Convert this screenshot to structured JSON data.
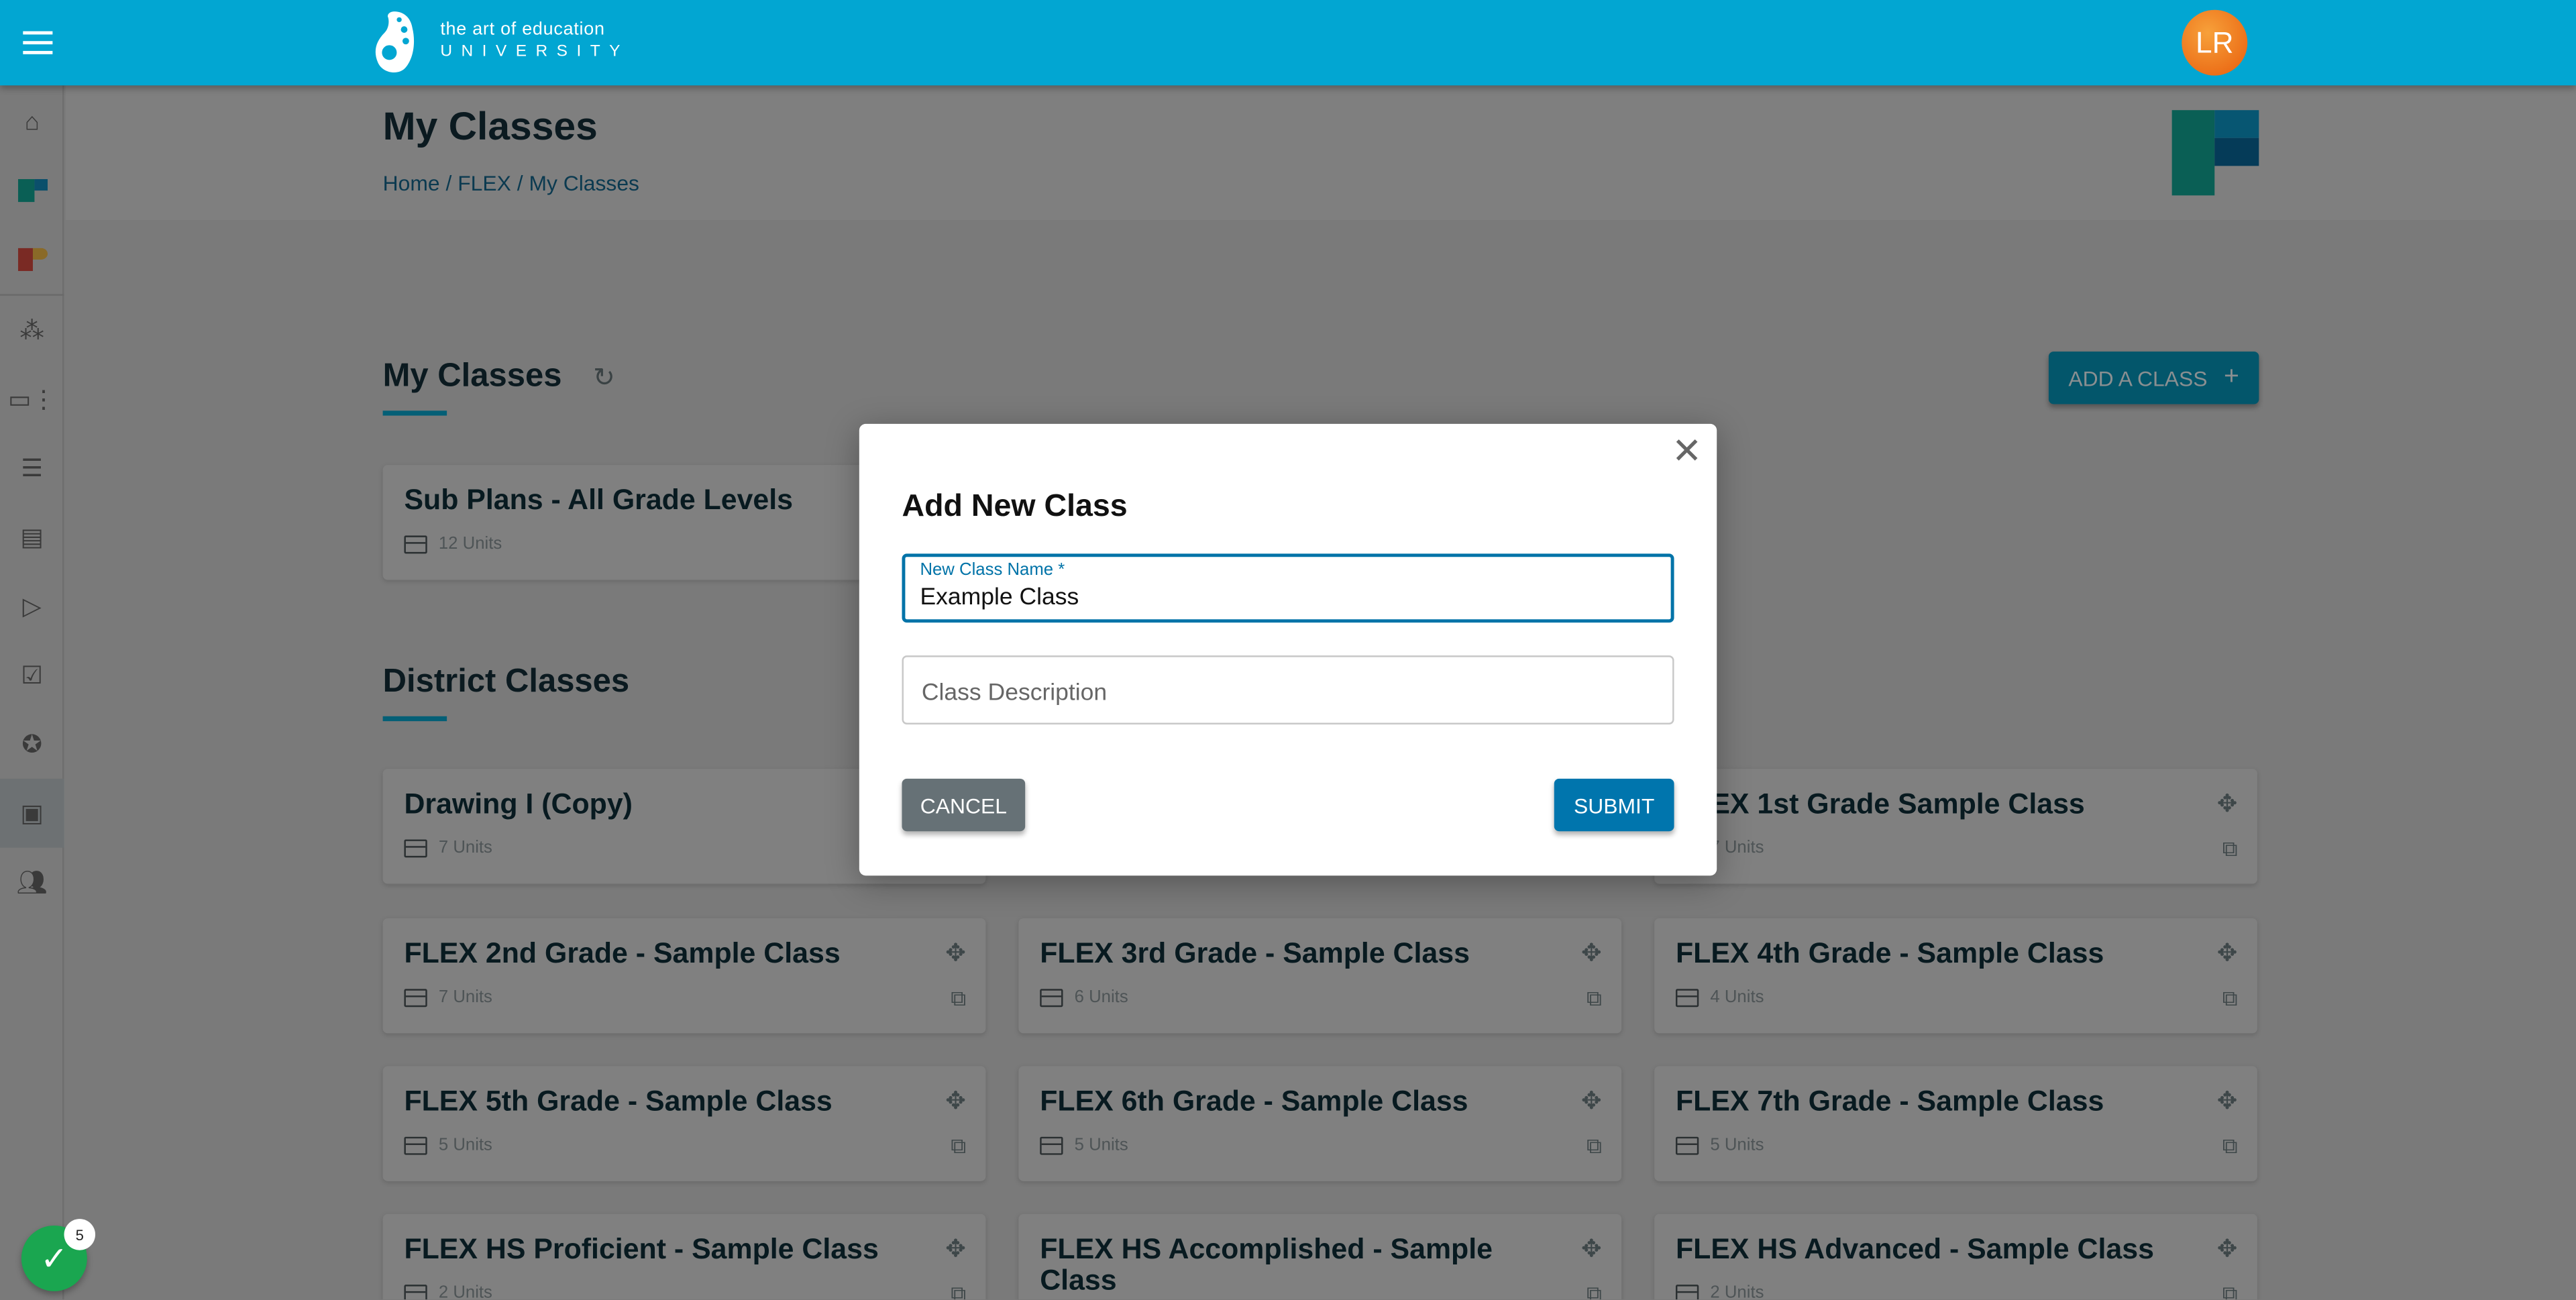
{
  "header": {
    "menu_icon": "hamburger-icon",
    "logo_line1": "the art of education",
    "logo_line2": "UNIVERSITY",
    "avatar_initials": "LR",
    "color": "#02a6d2"
  },
  "sidebar": {
    "items": [
      {
        "icon": "home-icon"
      },
      {
        "icon": "flex-icon"
      },
      {
        "icon": "pro-icon"
      },
      {
        "icon": "hierarchy-icon"
      },
      {
        "icon": "dashboard-icon"
      },
      {
        "icon": "list-icon"
      },
      {
        "icon": "document-icon"
      },
      {
        "icon": "play-icon"
      },
      {
        "icon": "checkbox-icon"
      },
      {
        "icon": "badge-icon"
      },
      {
        "icon": "classes-icon",
        "active": true
      },
      {
        "icon": "users-icon"
      }
    ]
  },
  "page": {
    "title": "My Classes",
    "breadcrumb": [
      "Home",
      "FLEX",
      "My Classes"
    ],
    "breadcrumb_sep": "/"
  },
  "my_classes": {
    "heading": "My Classes",
    "add_button": "ADD A CLASS",
    "cards": [
      {
        "title": "Sub Plans - All Grade Levels",
        "units": "12 Units"
      }
    ]
  },
  "district_classes": {
    "heading": "District Classes",
    "cards": [
      {
        "title": "Drawing I (Copy)",
        "units": "7 Units"
      },
      {
        "title": "",
        "units": ""
      },
      {
        "title": "FLEX 1st Grade Sample Class",
        "units": "7 Units"
      },
      {
        "title": "FLEX 2nd Grade - Sample Class",
        "units": "7 Units"
      },
      {
        "title": "FLEX 3rd Grade - Sample Class",
        "units": "6 Units"
      },
      {
        "title": "FLEX 4th Grade - Sample Class",
        "units": "4 Units"
      },
      {
        "title": "FLEX 5th Grade - Sample Class",
        "units": "5 Units"
      },
      {
        "title": "FLEX 6th Grade - Sample Class",
        "units": "5 Units"
      },
      {
        "title": "FLEX 7th Grade - Sample Class",
        "units": "5 Units"
      },
      {
        "title": "FLEX HS Proficient - Sample Class",
        "units": "2 Units"
      },
      {
        "title": "FLEX HS Accomplished - Sample Class",
        "units": ""
      },
      {
        "title": "FLEX HS Advanced - Sample Class",
        "units": "2 Units"
      }
    ]
  },
  "modal": {
    "title": "Add New Class",
    "name_label": "New Class Name *",
    "name_value": "Example Class",
    "description_placeholder": "Class Description",
    "cancel": "CANCEL",
    "submit": "SUBMIT"
  },
  "fab": {
    "badge": "5",
    "icon": "check-icon"
  }
}
